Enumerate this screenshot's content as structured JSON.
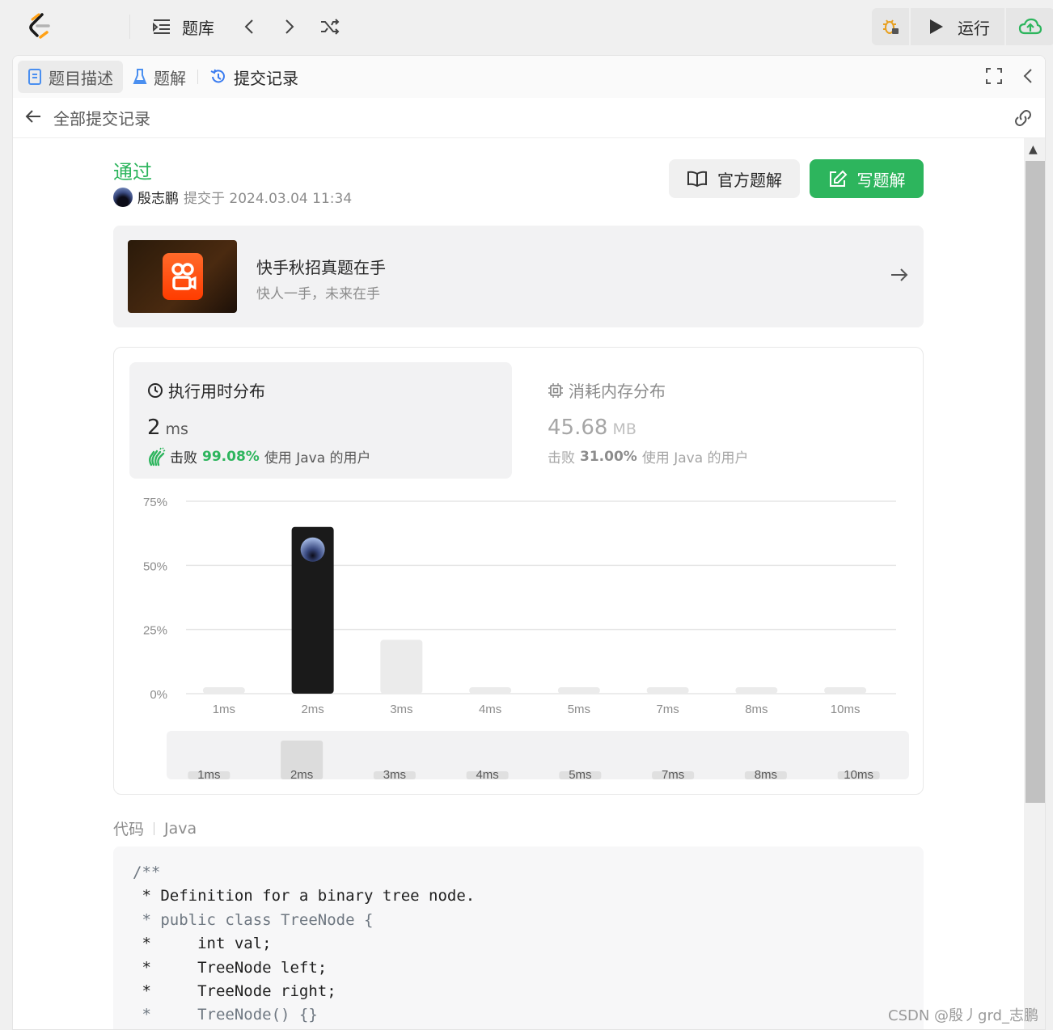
{
  "topbar": {
    "problems_label": "题库",
    "run_label": "运行",
    "icons": [
      "list-icon",
      "chevron-left-icon",
      "chevron-right-icon",
      "shuffle-icon",
      "debug-icon",
      "play-icon",
      "cloud-upload-icon"
    ]
  },
  "tabs": {
    "description": "题目描述",
    "solutions": "题解",
    "submissions": "提交记录"
  },
  "subhead": {
    "back_label": "全部提交记录"
  },
  "submission": {
    "status": "通过",
    "user": "殷志鹏",
    "submitted_at": "提交于 2024.03.04 11:34",
    "official_solution_label": "官方题解",
    "write_solution_label": "写题解"
  },
  "ad": {
    "title": "快手秋招真题在手",
    "subtitle": "快人一手，未来在手"
  },
  "runtime": {
    "title": "执行用时分布",
    "value": "2",
    "unit": "ms",
    "beat_prefix": "击败",
    "beat_pct": "99.08%",
    "beat_desc": "使用 Java 的用户"
  },
  "memory": {
    "title": "消耗内存分布",
    "value": "45.68",
    "unit": "MB",
    "beat_prefix": "击败",
    "beat_pct": "31.00%",
    "beat_desc": "使用 Java 的用户"
  },
  "chart_data": {
    "type": "bar",
    "categories": [
      "1ms",
      "2ms",
      "3ms",
      "4ms",
      "5ms",
      "7ms",
      "8ms",
      "10ms"
    ],
    "values": [
      0.5,
      65,
      21,
      0.5,
      0.5,
      0.5,
      0.5,
      0.5
    ],
    "highlight_category": "2ms",
    "y_ticks": [
      "0%",
      "25%",
      "50%",
      "75%"
    ],
    "ylim": [
      0,
      75
    ],
    "grid": true,
    "colors": {
      "highlight": "#1a1a1a",
      "normal": "#ebebeb",
      "grid": "#e5e5e5"
    }
  },
  "code": {
    "label": "代码",
    "language": "Java",
    "lines": [
      "/**",
      " * Definition for a binary tree node.",
      " * public class TreeNode {",
      " *     int val;",
      " *     TreeNode left;",
      " *     TreeNode right;",
      " *     TreeNode() {}"
    ]
  },
  "watermark": "CSDN @殷丿grd_志鹏",
  "colors": {
    "accent_green": "#2db55d",
    "background": "#f0f0f0"
  }
}
